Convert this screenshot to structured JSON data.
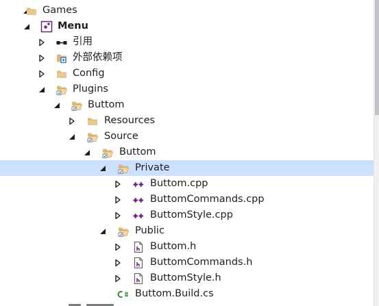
{
  "tree": {
    "rows": [
      {
        "label": "Games",
        "icon": "folder-icon",
        "expanded": true
      },
      {
        "label": "Menu",
        "icon": "cpp-project-icon",
        "expanded": true
      },
      {
        "label": "引用",
        "icon": "references-icon",
        "expanded": false
      },
      {
        "label": "外部依赖项",
        "icon": "external-dependencies-icon",
        "expanded": false
      },
      {
        "label": "Config",
        "icon": "folder-icon",
        "expanded": false
      },
      {
        "label": "Plugins",
        "icon": "folder-open-icon",
        "expanded": true
      },
      {
        "label": "Buttom",
        "icon": "folder-open-icon",
        "expanded": true
      },
      {
        "label": "Resources",
        "icon": "folder-icon",
        "expanded": false
      },
      {
        "label": "Source",
        "icon": "folder-open-icon",
        "expanded": true
      },
      {
        "label": "Buttom",
        "icon": "folder-open-icon",
        "expanded": true
      },
      {
        "label": "Private",
        "icon": "folder-open-icon",
        "expanded": true,
        "selected": true
      },
      {
        "label": "Buttom.cpp",
        "icon": "cpp-file-icon",
        "expanded": false
      },
      {
        "label": "ButtomCommands.cpp",
        "icon": "cpp-file-icon",
        "expanded": false
      },
      {
        "label": "ButtomStyle.cpp",
        "icon": "cpp-file-icon",
        "expanded": false
      },
      {
        "label": "Public",
        "icon": "folder-open-icon",
        "expanded": true
      },
      {
        "label": "Buttom.h",
        "icon": "header-file-icon",
        "expanded": false
      },
      {
        "label": "ButtomCommands.h",
        "icon": "header-file-icon",
        "expanded": false
      },
      {
        "label": "ButtomStyle.h",
        "icon": "header-file-icon",
        "expanded": false
      },
      {
        "label": "Buttom.Build.cs",
        "icon": "csharp-file-icon",
        "expanded": false
      }
    ]
  },
  "colors": {
    "selection": "#cce0ff",
    "folder": "#dcb67a",
    "cpp_icon": "#68217a",
    "csharp_icon": "#388a34",
    "text": "#1e1e1e"
  }
}
